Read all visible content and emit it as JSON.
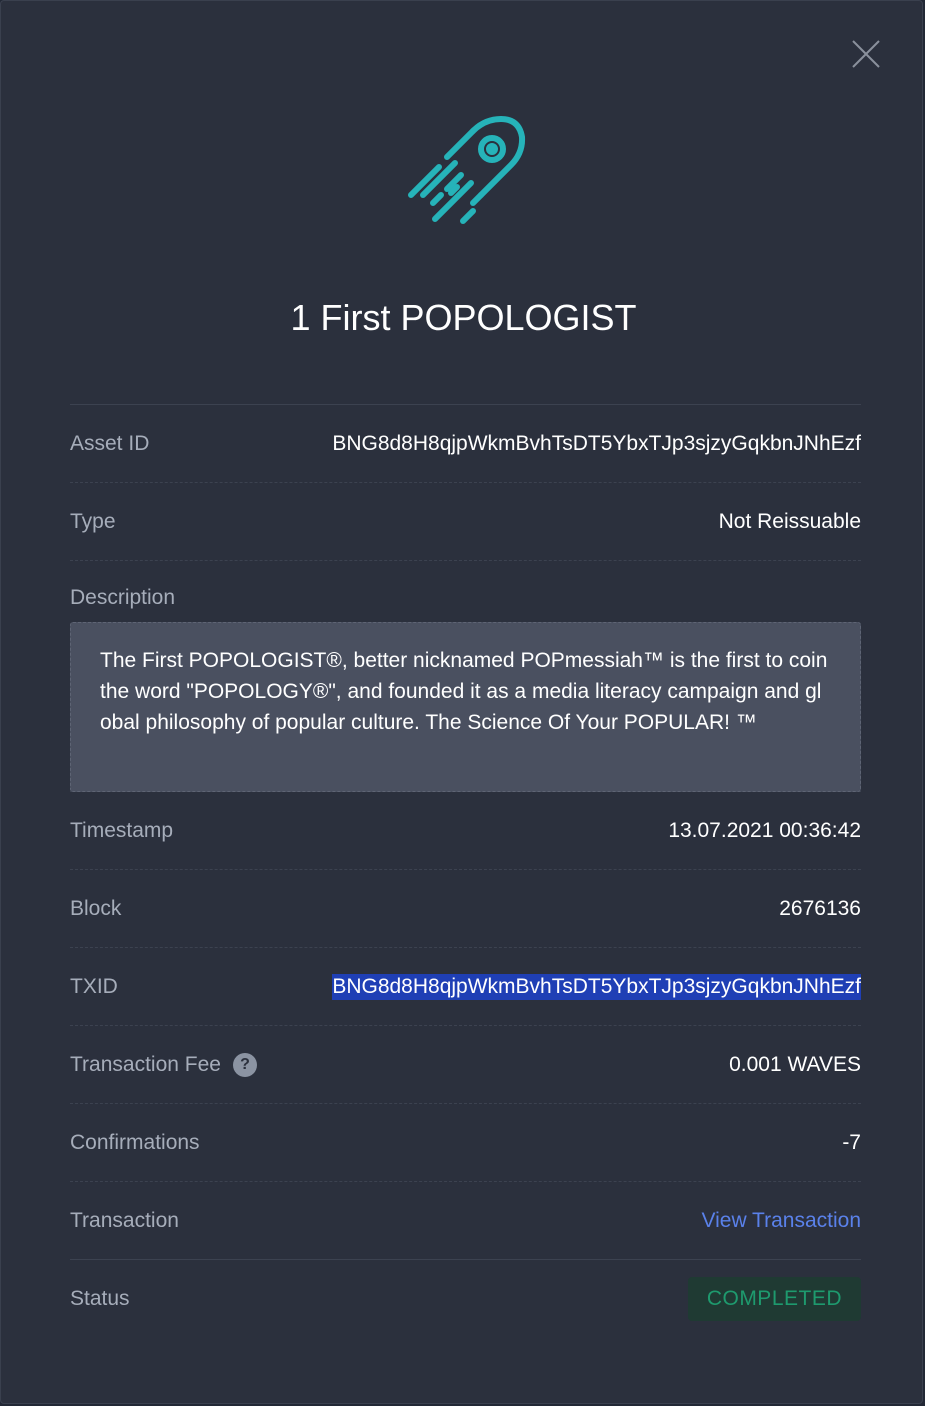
{
  "colors": {
    "background": "#2b303d",
    "accent_logo": "#26b3b9",
    "link": "#5a81ea",
    "status_completed": "#1e9a6e",
    "txid_highlight": "#1f3fb5"
  },
  "header": {
    "close_icon": "close-icon",
    "logo_icon": "comet-icon",
    "title": "1 First POPOLOGIST"
  },
  "details": {
    "asset_id": {
      "label": "Asset ID",
      "value": "BNG8d8H8qjpWkmBvhTsDT5YbxTJp3sjzyGqkbnJNhEzf"
    },
    "type": {
      "label": "Type",
      "value": "Not Reissuable"
    },
    "description": {
      "label": "Description",
      "value": "The First POPOLOGIST®, better nicknamed POPmessiah™ is the first to coin the word \"POPOLOGY®\", and founded it as a media literacy campaign and global philosophy of popular culture. The Science Of Your POPULAR! ™"
    },
    "timestamp": {
      "label": "Timestamp",
      "value": "13.07.2021 00:36:42"
    },
    "block": {
      "label": "Block",
      "value": "2676136"
    },
    "txid": {
      "label": "TXID",
      "value": "BNG8d8H8qjpWkmBvhTsDT5YbxTJp3sjzyGqkbnJNhEzf"
    },
    "fee": {
      "label": "Transaction Fee",
      "help": "?",
      "value": "0.001 WAVES"
    },
    "confirmations": {
      "label": "Confirmations",
      "value": "-7"
    },
    "transaction": {
      "label": "Transaction",
      "link_text": "View Transaction"
    },
    "status": {
      "label": "Status",
      "value": "COMPLETED"
    }
  }
}
